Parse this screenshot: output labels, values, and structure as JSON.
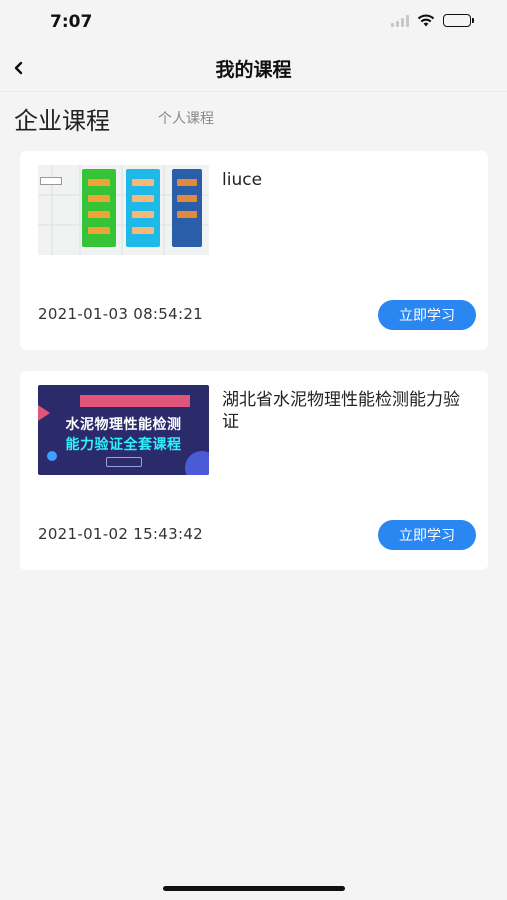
{
  "status_bar": {
    "time": "7:07",
    "icons": [
      "signal-icon",
      "wifi-icon",
      "battery-icon"
    ]
  },
  "nav": {
    "title": "我的课程",
    "back_icon": "chevron-left-icon"
  },
  "tabs": [
    {
      "label": "企业课程",
      "active": true
    },
    {
      "label": "个人课程",
      "active": false
    }
  ],
  "courses": [
    {
      "title": "liuce",
      "date": "2021-01-03 08:54:21",
      "button_label": "立即学习",
      "thumbnail": "diagram-thumbnail"
    },
    {
      "title": "湖北省水泥物理性能检测能力验证",
      "date": "2021-01-02 15:43:42",
      "button_label": "立即学习",
      "thumbnail": "banner-thumbnail",
      "banner": {
        "line1": "水泥物理性能检测",
        "line2": "能力验证全套课程"
      }
    }
  ],
  "colors": {
    "accent": "#2a86f0",
    "background": "#f4f4f4",
    "card": "#ffffff",
    "banner_bg": "#2b2a6b",
    "banner_highlight": "#2ff0ff"
  }
}
